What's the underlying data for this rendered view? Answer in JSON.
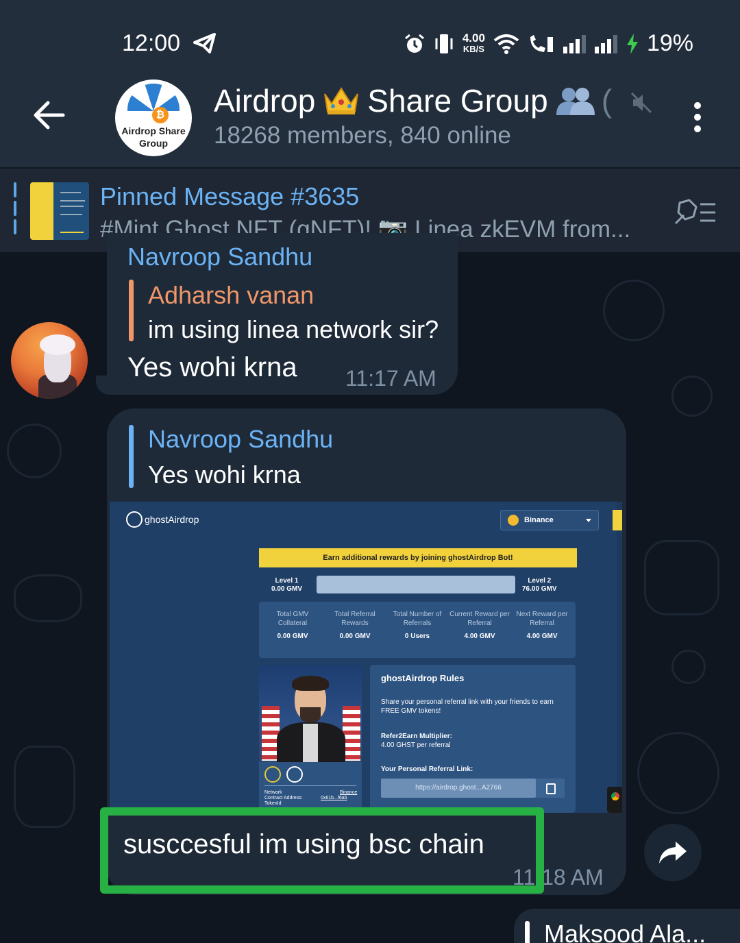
{
  "status_bar": {
    "time": "12:00",
    "net_speed_value": "4.00",
    "net_speed_unit": "KB/S",
    "battery": "19%"
  },
  "header": {
    "group_avatar_text": "Airdrop Share Group",
    "title_part1": "Airdrop",
    "title_part2": "Share Group",
    "title_paren": "(",
    "subtitle": "18268 members, 840 online"
  },
  "pinned": {
    "title": "Pinned Message #3635",
    "text": "#Mint Ghost NFT (gNFT)! 📷 Linea zkEVM from..."
  },
  "messages": {
    "m1": {
      "cut_sender": "Navroop Sandhu",
      "reply_sender": "Adharsh vanan",
      "reply_text": "im using linea network sir?",
      "text": "Yes wohi krna",
      "time": "11:17 AM"
    },
    "m2": {
      "reply_sender": "Navroop Sandhu",
      "reply_text": "Yes wohi krna",
      "text": "susccesful im using bsc chain",
      "time": "11:18 AM"
    },
    "m3": {
      "sender": "Maksood Ala..."
    }
  },
  "screenshot": {
    "logo": "ghostAirdrop",
    "network_select": "Binance",
    "banner": "Earn additional rewards by joining ghostAirdrop Bot!",
    "level1_label": "Level 1",
    "level1_value": "0.00 GMV",
    "level2_label": "Level 2",
    "level2_value": "76.00 GMV",
    "stats": [
      {
        "label": "Total GMV Collateral",
        "value": "0.00 GMV"
      },
      {
        "label": "Total Referral Rewards",
        "value": "0.00 GMV"
      },
      {
        "label": "Total Number of Referrals",
        "value": "0 Users"
      },
      {
        "label": "Current Reward per Referral",
        "value": "4.00 GMV"
      },
      {
        "label": "Next Reward per Referral",
        "value": "4.00 GMV"
      }
    ],
    "rules_title": "ghostAirdrop Rules",
    "rules_p1": "Share your personal referral link with your friends to earn FREE GMV tokens!",
    "rules_p2_title": "Refer2Earn Multiplier:",
    "rules_p2": "4.00 GHST per referral",
    "rules_p3_title": "Your Personal Referral Link:",
    "ref_link": "https://airdrop.ghost...A2766",
    "info_network_label": "Network",
    "info_network_value": "Binance",
    "info_contract_label": "Contract Address:",
    "info_contract_value": "0x61b...f6a5",
    "info_tokenid_label": "TokenId"
  },
  "colors": {
    "accent": "#6cb3f5",
    "reply_orange": "#f0976a",
    "highlight_green": "#27b043",
    "bubble": "#1e2a38"
  }
}
